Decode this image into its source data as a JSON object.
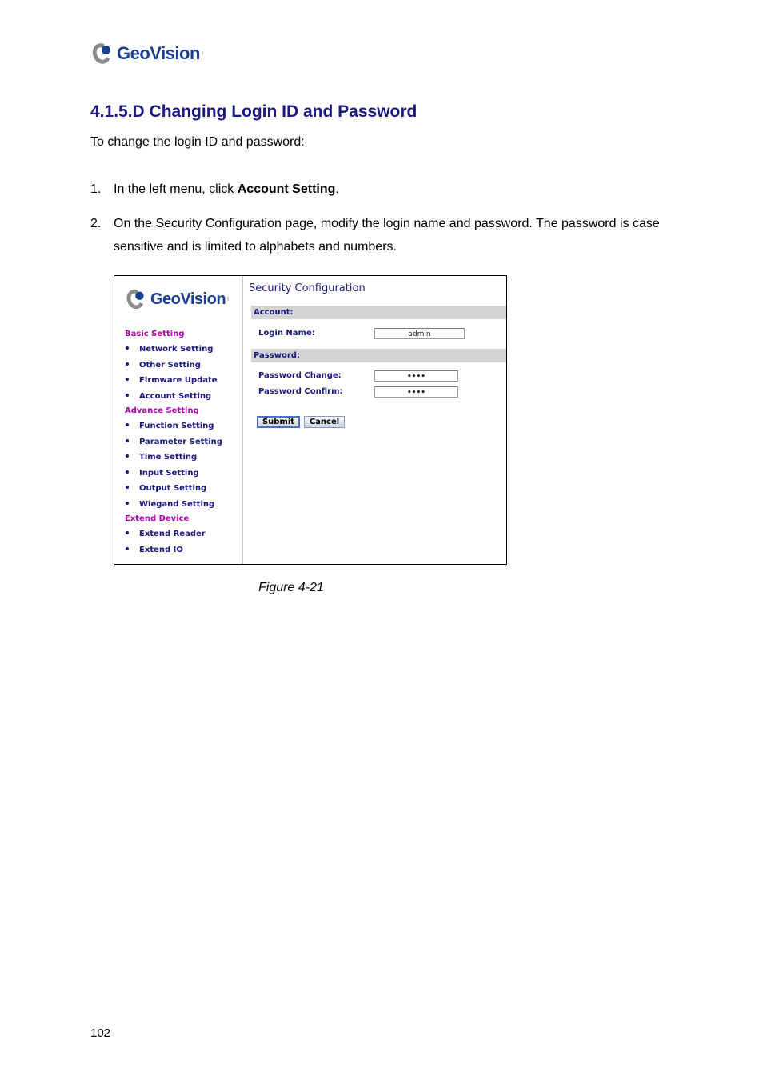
{
  "header": {
    "logo_text": "GeoVision",
    "logo_suffix": "inc"
  },
  "section": {
    "title": "4.1.5.D  Changing Login ID and Password",
    "intro": "To change the login ID and password:"
  },
  "steps": [
    {
      "num": "1.",
      "pre": "In the left menu, click ",
      "bold": "Account Setting",
      "post": "."
    },
    {
      "num": "2.",
      "text": "On the Security Configuration page, modify the login name and password. The password is case sensitive and is limited to alphabets and numbers."
    }
  ],
  "figure": {
    "logo_text": "GeoVision",
    "logo_suffix": "inc",
    "menu": [
      {
        "heading": "Basic Setting",
        "items": [
          "Network Setting",
          "Other Setting",
          "Firmware Update",
          "Account Setting"
        ]
      },
      {
        "heading": "Advance Setting",
        "items": [
          "Function Setting",
          "Parameter Setting",
          "Time Setting",
          "Input Setting",
          "Output Setting",
          "Wiegand Setting"
        ]
      },
      {
        "heading": "Extend Device",
        "items": [
          "Extend Reader",
          "Extend IO"
        ]
      }
    ],
    "page_title": "Security Configuration",
    "account_band": "Account:",
    "login_name_label": "Login Name:",
    "login_name_value": "admin",
    "password_band": "Password:",
    "password_change_label": "Password Change:",
    "password_change_value": "••••",
    "password_confirm_label": "Password Confirm:",
    "password_confirm_value": "••••",
    "submit_label": "Submit",
    "cancel_label": "Cancel"
  },
  "caption": "Figure 4-21",
  "footer": {
    "page_number": "102"
  },
  "colors": {
    "brand_blue": "#1b3f93",
    "heading_navy": "#1a1a80",
    "menu_heading_magenta": "#b000b0",
    "band_gray": "#d3d3d3"
  }
}
